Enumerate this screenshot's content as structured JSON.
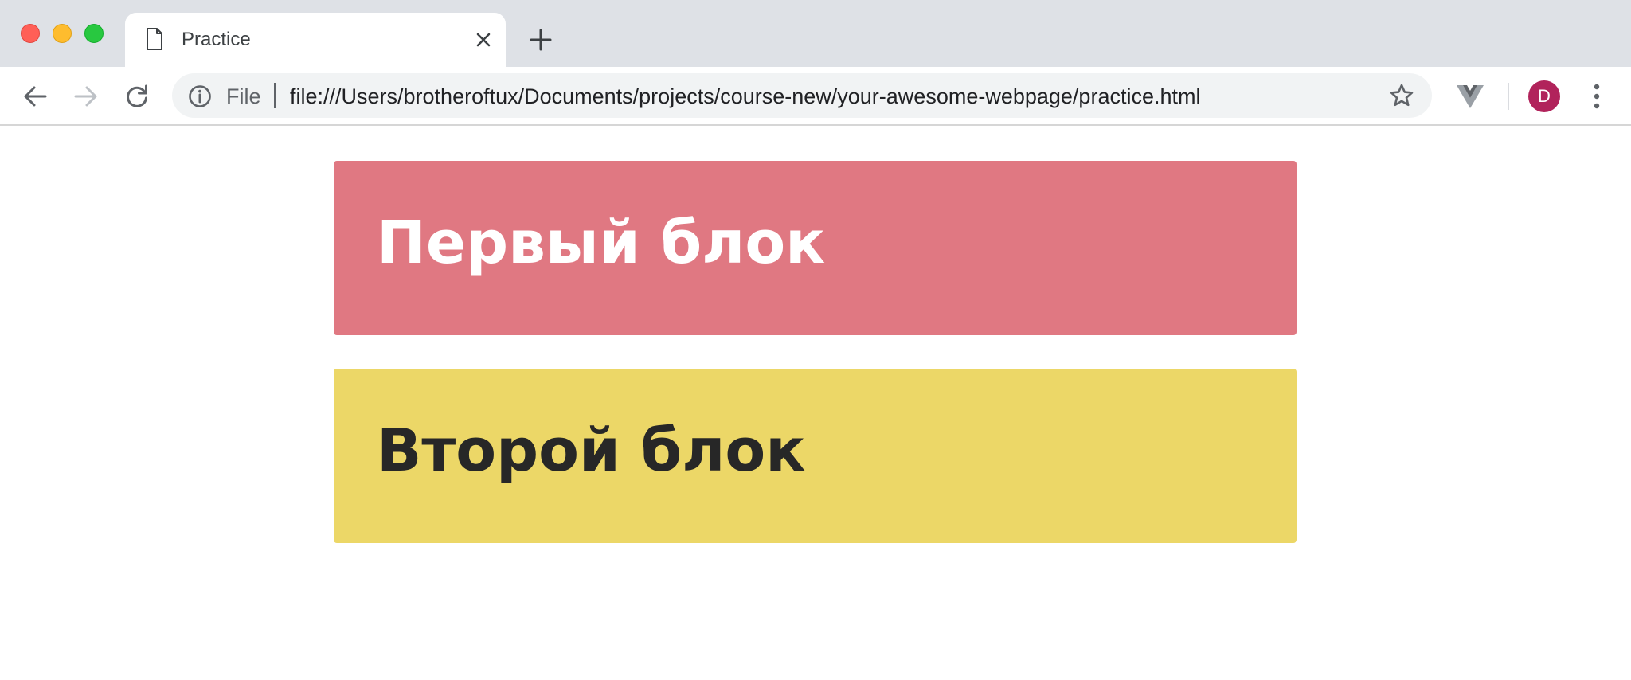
{
  "window": {
    "controls": [
      "close",
      "minimize",
      "zoom"
    ]
  },
  "tab": {
    "title": "Practice",
    "icon": "page-icon",
    "close_icon": "close-icon"
  },
  "new_tab_icon": "plus-icon",
  "toolbar": {
    "back_icon": "arrow-left-icon",
    "forward_icon": "arrow-right-icon",
    "reload_icon": "reload-icon",
    "omnibox": {
      "info_icon": "info-icon",
      "scheme_label": "File",
      "url": "file:///Users/brotheroftux/Documents/projects/course-new/your-awesome-webpage/practice.html",
      "bookmark_icon": "star-icon"
    },
    "extension_icon": "vue-devtools-icon",
    "avatar_initial": "D",
    "menu_icon": "more-vert-icon"
  },
  "page": {
    "blocks": [
      {
        "heading": "Первый блок",
        "background": "#e07882",
        "text_color": "#ffffff"
      },
      {
        "heading": "Второй блок",
        "background": "#ecd767",
        "text_color": "#272727"
      }
    ]
  },
  "colors": {
    "tabstrip": "#dee1e6",
    "omnibox": "#f1f3f4",
    "avatar": "#b1235b"
  }
}
